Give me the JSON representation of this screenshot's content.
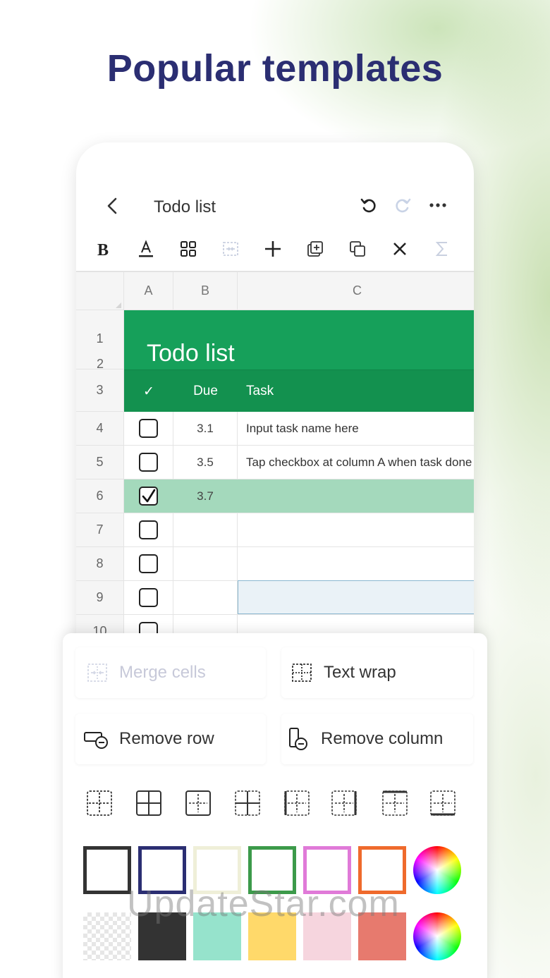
{
  "headline": "Popular templates",
  "topbar": {
    "title": "Todo list"
  },
  "sheet": {
    "columns": [
      "A",
      "B",
      "C"
    ],
    "rows": [
      "1",
      "2",
      "3",
      "4",
      "5",
      "6",
      "7",
      "8",
      "9",
      "10"
    ],
    "title": "Todo list",
    "header": {
      "check": "✓",
      "due": "Due",
      "task": "Task"
    },
    "tasks": [
      {
        "done": false,
        "due": "3.1",
        "task": "Input task name here"
      },
      {
        "done": false,
        "due": "3.5",
        "task": "Tap checkbox at column A when task done"
      },
      {
        "done": true,
        "due": "3.7",
        "task": ""
      },
      {
        "done": false,
        "due": "",
        "task": ""
      },
      {
        "done": false,
        "due": "",
        "task": ""
      },
      {
        "done": false,
        "due": "",
        "task": ""
      }
    ]
  },
  "panel": {
    "merge_cells": "Merge cells",
    "text_wrap": "Text wrap",
    "remove_row": "Remove row",
    "remove_column": "Remove column",
    "border_colors": [
      "#333333",
      "#2b2e72",
      "#efefd8",
      "#3c9a4a",
      "#e07ad8",
      "#ef6a2c"
    ],
    "fill_colors": [
      "transparent",
      "#333333",
      "#96e3cc",
      "#ffd96a",
      "#f6d5de",
      "#e77a6e"
    ]
  },
  "watermark": "UpdateStar.com",
  "colors": {
    "title_band": "#16a05a",
    "header_band": "#13914f",
    "done_row": "#a4d9bc",
    "headline": "#2b2e72"
  }
}
